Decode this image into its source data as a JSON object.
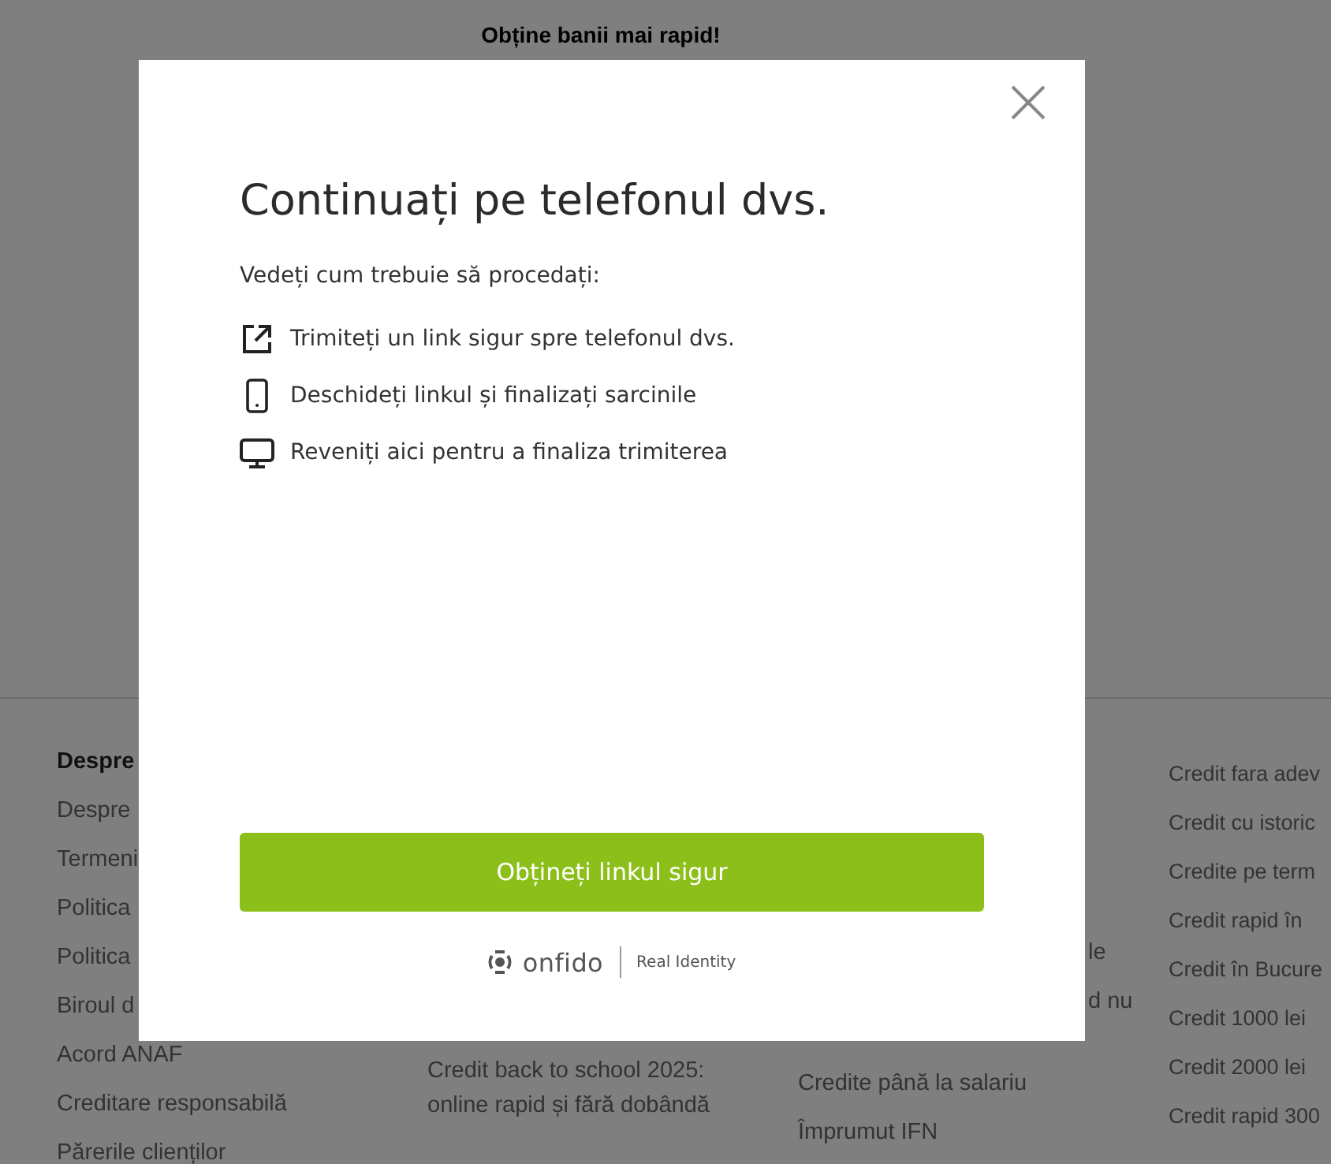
{
  "top_banner": {
    "text": "Obține banii mai rapid!"
  },
  "footer": {
    "columns": [
      {
        "items": [
          {
            "kind": "heading",
            "text": "Despre"
          },
          {
            "kind": "link",
            "text": "Despre"
          },
          {
            "kind": "link",
            "text": "Termeni"
          },
          {
            "kind": "link",
            "text": "Politica"
          },
          {
            "kind": "link",
            "text": "Politica"
          },
          {
            "kind": "link",
            "text": "Biroul d"
          },
          {
            "kind": "link",
            "text": "Acord ANAF"
          },
          {
            "kind": "link",
            "text": "Creditare responsabilă"
          },
          {
            "kind": "link",
            "text": "Părerile clienților"
          }
        ]
      },
      {
        "items": [
          {
            "kind": "link",
            "text": "Credit back to school 2025: online rapid și fără dobândă"
          }
        ]
      },
      {
        "items": [
          {
            "kind": "fragment",
            "text": "le"
          },
          {
            "kind": "fragment",
            "text": "d nu"
          },
          {
            "kind": "link",
            "text": "Credite până la salariu"
          },
          {
            "kind": "link",
            "text": "Împrumut IFN"
          }
        ]
      },
      {
        "items": [
          {
            "kind": "link",
            "text": "Credit fara adev"
          },
          {
            "kind": "link",
            "text": "Credit cu istoric"
          },
          {
            "kind": "link",
            "text": "Credite pe term"
          },
          {
            "kind": "link",
            "text": "Credit rapid în"
          },
          {
            "kind": "link",
            "text": "Credit în Bucure"
          },
          {
            "kind": "link",
            "text": "Credit 1000 lei"
          },
          {
            "kind": "link",
            "text": "Credit 2000 lei"
          },
          {
            "kind": "link",
            "text": "Credit rapid 300"
          }
        ]
      }
    ]
  },
  "modal": {
    "title": "Continuați pe telefonul dvs.",
    "subtitle": "Vedeți cum trebuie să procedați:",
    "steps": [
      {
        "kind": "link",
        "text": "Trimiteți un link sigur spre telefonul dvs."
      },
      {
        "kind": "phone",
        "text": "Deschideți linkul și finalizați sarcinile"
      },
      {
        "kind": "desktop",
        "text": "Reveniți aici pentru a finaliza trimiterea"
      }
    ],
    "button": "Obțineți linkul sigur",
    "brand": {
      "name": "onfido",
      "tagline": "Real Identity"
    }
  }
}
